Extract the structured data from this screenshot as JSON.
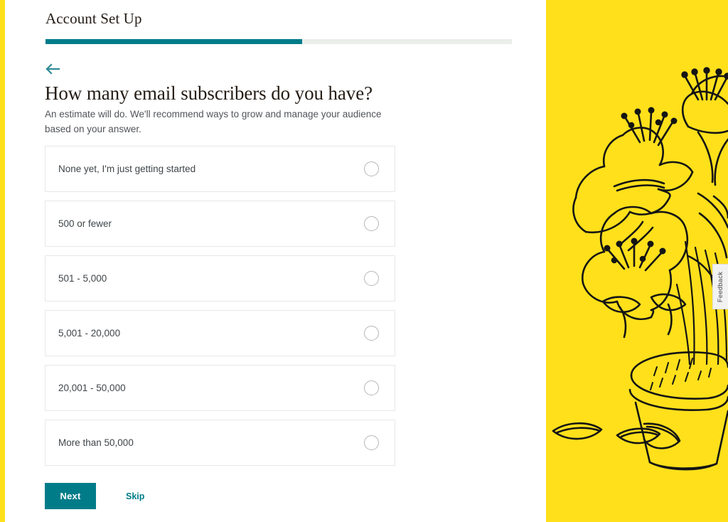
{
  "colors": {
    "teal": "#007c89",
    "yellow": "#ffe01b",
    "track": "#eceeeb",
    "text_dark": "#241c15",
    "text_body": "#51545a"
  },
  "header": {
    "title": "Account Set Up"
  },
  "progress": {
    "percent": 55
  },
  "back": {
    "icon": "arrow-left-icon"
  },
  "question": {
    "heading": "How many email subscribers do you have?",
    "subtitle": "An estimate will do. We'll recommend ways to grow and manage your audience based on your answer."
  },
  "options": [
    {
      "label": "None yet, I'm just getting started",
      "selected": false
    },
    {
      "label": "500 or fewer",
      "selected": false
    },
    {
      "label": "501 - 5,000",
      "selected": false
    },
    {
      "label": "5,001 - 20,000",
      "selected": false
    },
    {
      "label": "20,001 - 50,000",
      "selected": false
    },
    {
      "label": "More than 50,000",
      "selected": false
    }
  ],
  "actions": {
    "next_label": "Next",
    "skip_label": "Skip"
  },
  "feedback": {
    "label": "Feedback"
  },
  "illustration": {
    "name": "lily-flowers-in-pot-line-art",
    "background": "#ffe01b",
    "line_color": "#141414"
  }
}
